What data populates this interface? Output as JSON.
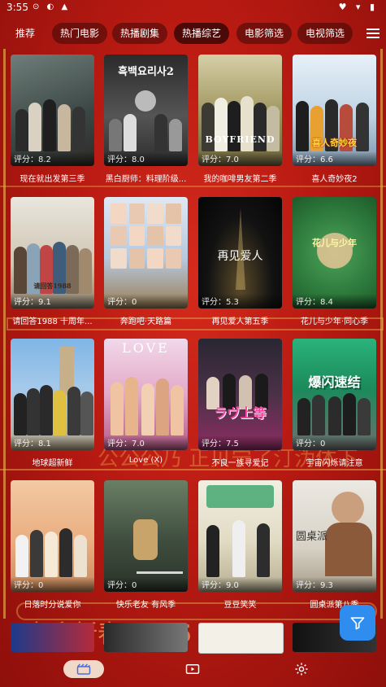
{
  "status_bar": {
    "time": "3:55"
  },
  "tabs": [
    {
      "label": "推荐",
      "active": false
    },
    {
      "label": "热门电影",
      "active": false
    },
    {
      "label": "热播剧集",
      "active": false
    },
    {
      "label": "热播综艺",
      "active": true
    },
    {
      "label": "电影筛选",
      "active": false
    },
    {
      "label": "电视筛选",
      "active": false
    }
  ],
  "cards": [
    {
      "title": "现在就出发第三季",
      "score": "评分：8.2",
      "poster_text": ""
    },
    {
      "title": "黑白厨师：料理阶级...",
      "score": "评分：8.0",
      "poster_text": "흑백요리사2"
    },
    {
      "title": "我的咖啡男友第二季",
      "score": "评分：7.0",
      "poster_text": "BOYFRIEND"
    },
    {
      "title": "喜人奇妙夜2",
      "score": "评分：6.6",
      "poster_text": "喜人奇妙夜"
    },
    {
      "title": "请回答1988 十周年...",
      "score": "评分：9.1",
      "poster_text": "请回答1988"
    },
    {
      "title": "奔跑吧·天路篇",
      "score": "评分：0",
      "poster_text": ""
    },
    {
      "title": "再见爱人第五季",
      "score": "评分：5.3",
      "poster_text": "再见爱人"
    },
    {
      "title": "花儿与少年·同心季",
      "score": "评分：8.4",
      "poster_text": "花儿与少年"
    },
    {
      "title": "地球超新鲜",
      "score": "评分：8.1",
      "poster_text": ""
    },
    {
      "title": "Love (X)",
      "score": "评分：7.0",
      "poster_text": "LOVE"
    },
    {
      "title": "不良一族寻爱记",
      "score": "评分：7.5",
      "poster_text": "ラヴ上等"
    },
    {
      "title": "宇宙闪烁请注意",
      "score": "评分：0",
      "poster_text": "爆闪速结"
    },
    {
      "title": "日落时分说爱你",
      "score": "评分：0",
      "poster_text": ""
    },
    {
      "title": "快乐老友 有风季",
      "score": "评分：0",
      "poster_text": ""
    },
    {
      "title": "豆豆笑笑",
      "score": "评分：9.0",
      "poster_text": ""
    },
    {
      "title": "圆桌派第八季",
      "score": "评分：9.3",
      "poster_text": "圆桌派"
    }
  ],
  "colors": {
    "accent": "#2f8df0",
    "background": "#b81a12",
    "gold": "#e8b04a"
  },
  "bottom_nav": [
    {
      "icon": "clapperboard-icon",
      "active": true
    },
    {
      "icon": "play-tv-icon",
      "active": false
    },
    {
      "icon": "settings-gear-icon",
      "active": false
    }
  ],
  "fab": {
    "icon": "filter-icon"
  }
}
